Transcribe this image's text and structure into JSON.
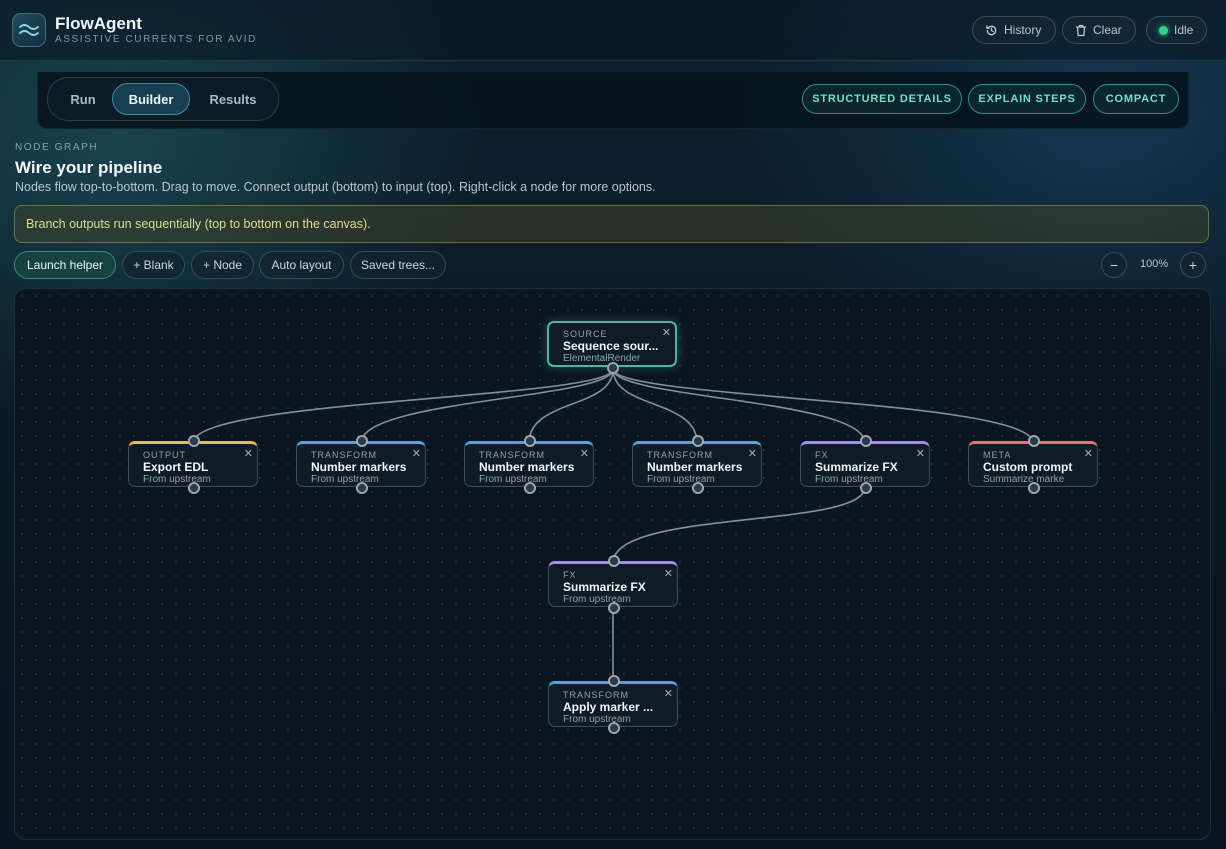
{
  "header": {
    "app_title": "FlowAgent",
    "app_subtitle": "ASSISTIVE CURRENTS FOR AVID",
    "history_label": "History",
    "clear_label": "Clear",
    "status_label": "Idle"
  },
  "tabs": {
    "run": "Run",
    "builder": "Builder",
    "results": "Results",
    "active": "Builder"
  },
  "view_toggles": {
    "structured": "STRUCTURED DETAILS",
    "explain": "EXPLAIN STEPS",
    "compact": "COMPACT"
  },
  "section": {
    "eyebrow": "NODE GRAPH",
    "title": "Wire your pipeline",
    "description": "Nodes flow top-to-bottom. Drag to move. Connect output (bottom) to input (top). Right-click a node for more options."
  },
  "notice": "Branch outputs run sequentially (top to bottom on the canvas).",
  "toolbar": {
    "launch_helper": "Launch helper",
    "blank": "+ Blank",
    "node": "+ Node",
    "auto_layout": "Auto layout",
    "saved_trees": "Saved trees...",
    "zoom_out": "−",
    "zoom_level": "100%",
    "zoom_in": "+"
  },
  "colors": {
    "source": "#48b5a8",
    "output": "#f0b84a",
    "transform": "#4aa8e0",
    "fx": "#a98bf0",
    "meta": "#e8707a"
  },
  "nodes": {
    "source": {
      "type": "SOURCE",
      "label": "Sequence sour...",
      "sub": "ElementalRender"
    },
    "output": {
      "type": "OUTPUT",
      "label": "Export EDL",
      "sub": "From upstream"
    },
    "transform1": {
      "type": "TRANSFORM",
      "label": "Number markers",
      "sub": "From upstream"
    },
    "transform2": {
      "type": "TRANSFORM",
      "label": "Number markers",
      "sub": "From upstream"
    },
    "transform3": {
      "type": "TRANSFORM",
      "label": "Number markers",
      "sub": "From upstream"
    },
    "fx1": {
      "type": "FX",
      "label": "Summarize FX",
      "sub": "From upstream"
    },
    "meta": {
      "type": "META",
      "label": "Custom prompt",
      "sub": "Summarize marke"
    },
    "fx2": {
      "type": "FX",
      "label": "Summarize FX",
      "sub": "From upstream"
    },
    "transform4": {
      "type": "TRANSFORM",
      "label": "Apply marker ...",
      "sub": "From upstream"
    }
  }
}
